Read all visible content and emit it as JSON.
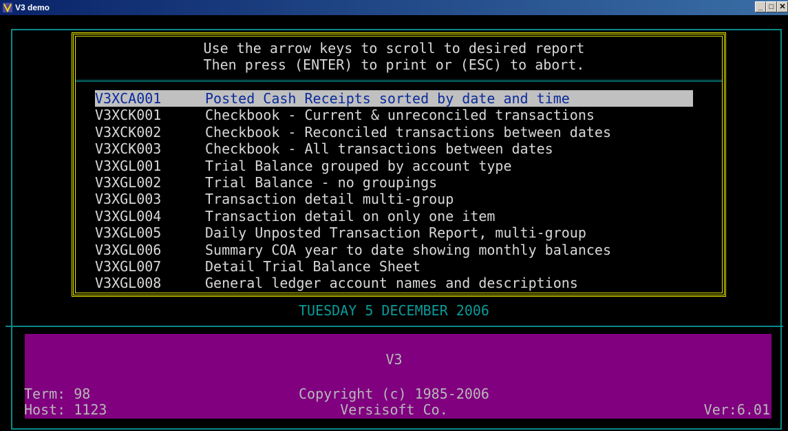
{
  "window": {
    "title": "V3 demo",
    "buttons": {
      "minimize": "_",
      "maximize": "□",
      "close": "✕"
    }
  },
  "instructions": {
    "line1": "Use the arrow keys to scroll to desired report",
    "line2": "Then press (ENTER) to print or (ESC) to abort."
  },
  "reports": [
    {
      "code": "V3XCA001",
      "desc": "Posted Cash Receipts sorted by date and time",
      "selected": true
    },
    {
      "code": "V3XCK001",
      "desc": "Checkbook - Current & unreconciled transactions"
    },
    {
      "code": "V3XCK002",
      "desc": "Checkbook - Reconciled transactions between dates"
    },
    {
      "code": "V3XCK003",
      "desc": "Checkbook - All transactions between dates"
    },
    {
      "code": "V3XGL001",
      "desc": "Trial Balance grouped by account type"
    },
    {
      "code": "V3XGL002",
      "desc": "Trial Balance - no groupings"
    },
    {
      "code": "V3XGL003",
      "desc": "Transaction detail multi-group"
    },
    {
      "code": "V3XGL004",
      "desc": "Transaction detail on only one item"
    },
    {
      "code": "V3XGL005",
      "desc": "Daily Unposted Transaction Report, multi-group"
    },
    {
      "code": "V3XGL006",
      "desc": "Summary COA year to date showing monthly balances"
    },
    {
      "code": "V3XGL007",
      "desc": "Detail Trial Balance Sheet"
    },
    {
      "code": "V3XGL008",
      "desc": "General ledger account names and descriptions"
    }
  ],
  "date": "TUESDAY 5 DECEMBER 2006",
  "footer": {
    "product": "V3",
    "term": "Term: 98",
    "host": "Host: 1123",
    "copyright": "Copyright (c) 1985-2006",
    "vendor": "Versisoft Co.",
    "version": "Ver:6.01"
  },
  "colors": {
    "accent_teal": "#0b8a8a",
    "border_yellow": "#e8e800",
    "footer_purple": "#800080",
    "selection_bg": "#c0c0c0",
    "selection_text": "#0a2a9a"
  }
}
